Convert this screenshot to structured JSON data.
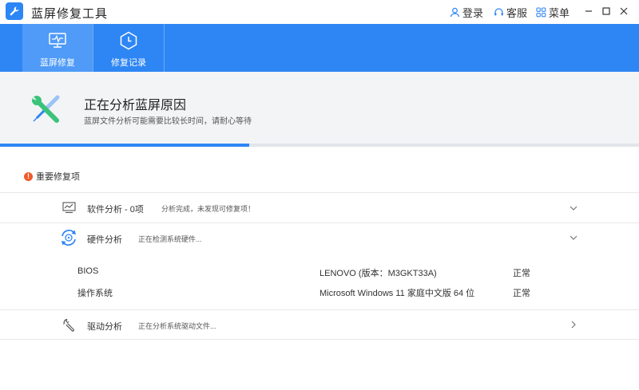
{
  "app": {
    "title": "蓝屏修复工具"
  },
  "titlebar": {
    "login_label": "登录",
    "service_label": "客服",
    "menu_label": "菜单"
  },
  "tabs": [
    {
      "label": "蓝屏修复",
      "icon": "monitor-pulse-icon",
      "active": true
    },
    {
      "label": "修复记录",
      "icon": "clock-hexagon-icon",
      "active": false
    }
  ],
  "status": {
    "title": "正在分析蓝屏原因",
    "subtitle": "蓝屏文件分析可能需要比较长时间，请耐心等待",
    "progress_fraction": 0.39
  },
  "section": {
    "warn_glyph": "!",
    "label": "重要修复项"
  },
  "rows": [
    {
      "title": "软件分析 - 0项",
      "note": "分析完成，未发现可修复项！",
      "icon": "chart-icon",
      "chevron": "down"
    },
    {
      "title": "硬件分析",
      "note": "正在检测系统硬件...",
      "icon": "refresh-disc-icon",
      "chevron": "down"
    },
    {
      "title": "驱动分析",
      "note": "正在分析系统驱动文件...",
      "icon": "wrench-icon",
      "chevron": "right"
    }
  ],
  "hardware_details": [
    {
      "name": "BIOS",
      "value": "LENOVO (版本：M3GKT33A)",
      "status": "正常"
    },
    {
      "name": "操作系统",
      "value": "Microsoft Windows 11 家庭中文版 64 位",
      "status": "正常"
    }
  ],
  "colors": {
    "accent": "#2e86f4",
    "tab_active": "#4f9bf7",
    "warning": "#ef5a2a",
    "header_bg": "#f3f4f6"
  }
}
